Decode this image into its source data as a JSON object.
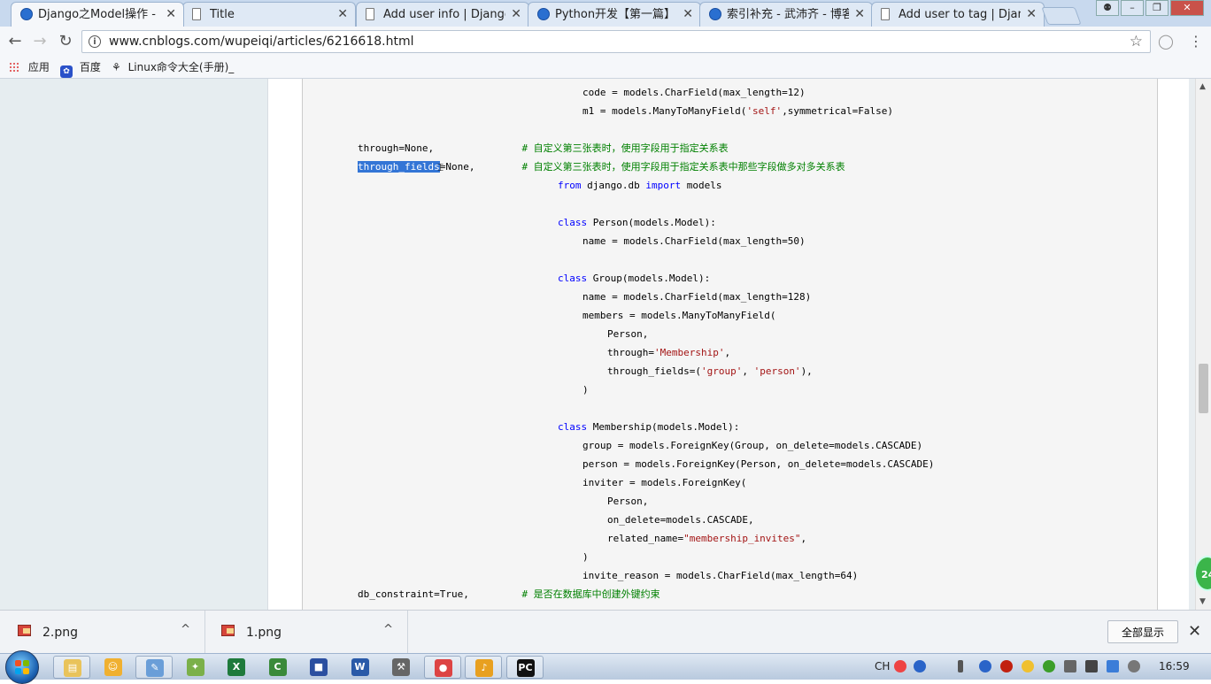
{
  "browser": {
    "tabs": [
      {
        "title": "Django之Model操作 - ",
        "icon": "cnblogs-favicon",
        "active": true
      },
      {
        "title": "Title",
        "icon": "page-icon"
      },
      {
        "title": "Add user info | Django",
        "icon": "page-icon"
      },
      {
        "title": "Python开发【第一篇】",
        "icon": "cnblogs-favicon"
      },
      {
        "title": "索引补充 - 武沛齐 - 博客",
        "icon": "cnblogs-favicon"
      },
      {
        "title": "Add user to tag | Djang",
        "icon": "page-icon"
      }
    ],
    "close_glyph": "✕",
    "url": "www.cnblogs.com/wupeiqi/articles/6216618.html",
    "bookmarks": [
      {
        "label": "应用",
        "icon": "apps-grid-icon"
      },
      {
        "label": "百度",
        "icon": "baidu-paw-icon"
      },
      {
        "label": "Linux命令大全(手册)_",
        "icon": "linux-cmd-icon"
      }
    ]
  },
  "code": {
    "lines": [
      {
        "indent": 4,
        "parts": [
          {
            "t": "code = models.CharField(max_length=12)"
          }
        ]
      },
      {
        "indent": 4,
        "parts": [
          {
            "t": "m1 = models.ManyToManyField("
          },
          {
            "t": "'self'",
            "c": "str"
          },
          {
            "t": ",symmetrical=False)"
          }
        ]
      },
      {
        "indent": 0,
        "parts": []
      },
      {
        "indent": 0,
        "parts": [
          {
            "t": "through=None,               "
          },
          {
            "t": "# 自定义第三张表时，使用字段用于指定关系表",
            "c": "cm"
          }
        ]
      },
      {
        "indent": 0,
        "parts": [
          {
            "t": "through_fields",
            "c": "sel"
          },
          {
            "t": "=None,        "
          },
          {
            "t": "# 自定义第三张表时，使用字段用于指定关系表中那些字段做多对多关系表",
            "c": "cm"
          }
        ]
      },
      {
        "indent": 3,
        "parts": [
          {
            "t": "from",
            "c": "kw"
          },
          {
            "t": " django.db "
          },
          {
            "t": "import",
            "c": "kw"
          },
          {
            "t": " models"
          }
        ]
      },
      {
        "indent": 0,
        "parts": []
      },
      {
        "indent": 3,
        "parts": [
          {
            "t": "class",
            "c": "kw"
          },
          {
            "t": " Person(models.Model):"
          }
        ]
      },
      {
        "indent": 4,
        "parts": [
          {
            "t": "name = models.CharField(max_length=50)"
          }
        ]
      },
      {
        "indent": 0,
        "parts": []
      },
      {
        "indent": 3,
        "parts": [
          {
            "t": "class",
            "c": "kw"
          },
          {
            "t": " Group(models.Model):"
          }
        ]
      },
      {
        "indent": 4,
        "parts": [
          {
            "t": "name = models.CharField(max_length=128)"
          }
        ]
      },
      {
        "indent": 4,
        "parts": [
          {
            "t": "members = models.ManyToManyField("
          }
        ]
      },
      {
        "indent": 5,
        "parts": [
          {
            "t": "Person,"
          }
        ]
      },
      {
        "indent": 5,
        "parts": [
          {
            "t": "through="
          },
          {
            "t": "'Membership'",
            "c": "str"
          },
          {
            "t": ","
          }
        ]
      },
      {
        "indent": 5,
        "parts": [
          {
            "t": "through_fields=("
          },
          {
            "t": "'group'",
            "c": "str"
          },
          {
            "t": ", "
          },
          {
            "t": "'person'",
            "c": "str"
          },
          {
            "t": "),"
          }
        ]
      },
      {
        "indent": 4,
        "parts": [
          {
            "t": ")"
          }
        ]
      },
      {
        "indent": 0,
        "parts": []
      },
      {
        "indent": 3,
        "parts": [
          {
            "t": "class",
            "c": "kw"
          },
          {
            "t": " Membership(models.Model):"
          }
        ]
      },
      {
        "indent": 4,
        "parts": [
          {
            "t": "group = models.ForeignKey(Group, on_delete=models.CASCADE)"
          }
        ]
      },
      {
        "indent": 4,
        "parts": [
          {
            "t": "person = models.ForeignKey(Person, on_delete=models.CASCADE)"
          }
        ]
      },
      {
        "indent": 4,
        "parts": [
          {
            "t": "inviter = models.ForeignKey("
          }
        ]
      },
      {
        "indent": 5,
        "parts": [
          {
            "t": "Person,"
          }
        ]
      },
      {
        "indent": 5,
        "parts": [
          {
            "t": "on_delete=models.CASCADE,"
          }
        ]
      },
      {
        "indent": 5,
        "parts": [
          {
            "t": "related_name="
          },
          {
            "t": "\"membership_invites\"",
            "c": "str"
          },
          {
            "t": ","
          }
        ]
      },
      {
        "indent": 4,
        "parts": [
          {
            "t": ")"
          }
        ]
      },
      {
        "indent": 4,
        "parts": [
          {
            "t": "invite_reason = models.CharField(max_length=64)"
          }
        ]
      },
      {
        "indent": 0,
        "parts": [
          {
            "t": "db_constraint=True,         "
          },
          {
            "t": "# 是否在数据库中创建外键约束",
            "c": "cm"
          }
        ]
      }
    ]
  },
  "downloads": {
    "items": [
      {
        "name": "2.png",
        "icon": "image-file-icon"
      },
      {
        "name": "1.png",
        "icon": "image-file-icon"
      }
    ],
    "show_all": "全部显示",
    "chevron": "^",
    "close": "✕"
  },
  "side_badge": "24",
  "taskbar": {
    "apps": [
      "file-explorer-icon",
      "paint-icon",
      "notepad-icon",
      "app-icon",
      "excel-icon",
      "camtasia-icon",
      "save-icon",
      "word-icon",
      "tools-icon",
      "chrome-icon",
      "audio-icon",
      "pycharm-icon"
    ],
    "tray_lang": "CH",
    "clock": "16:59"
  }
}
